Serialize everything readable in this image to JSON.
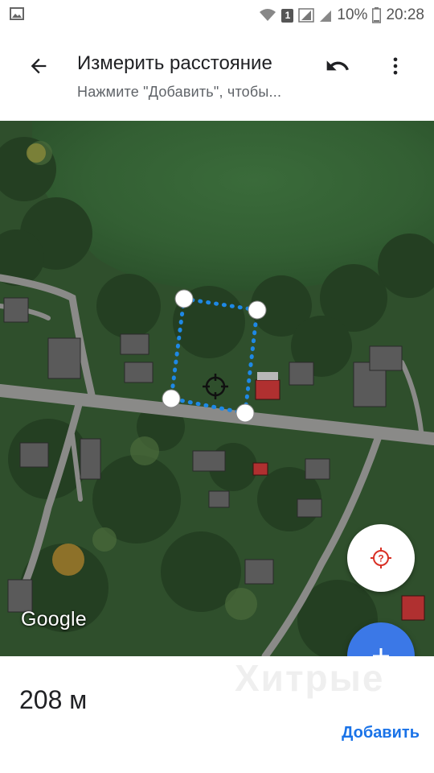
{
  "status_bar": {
    "battery": "10%",
    "time": "20:28",
    "sim": "1"
  },
  "app_bar": {
    "title": "Измерить расстояние",
    "subtitle": "Нажмите \"Добавить\", чтобы...",
    "back_icon": "arrow-back-icon",
    "undo_icon": "undo-icon",
    "more_icon": "more-vert-icon"
  },
  "map": {
    "attribution": "Google",
    "layer": "satellite"
  },
  "controls": {
    "location_icon": "my-location-icon",
    "add_icon": "plus-icon"
  },
  "result": {
    "distance": "208 м",
    "add_label": "Добавить",
    "watermark": "Хитрые"
  },
  "colors": {
    "accent": "#1a73e8",
    "fab_blue": "#3b78e7",
    "path": "#1e88e5",
    "location_red": "#d93025"
  }
}
